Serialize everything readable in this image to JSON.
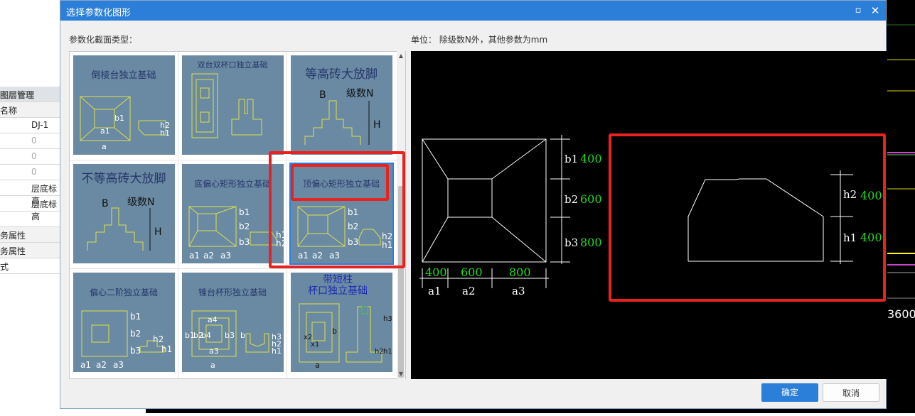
{
  "background": {
    "left_panel": {
      "header": "图层管理",
      "rows": [
        {
          "c1": "名称",
          "c2": ""
        },
        {
          "c1": "",
          "c2": "DJ-1"
        },
        {
          "c1": "",
          "c2": "0"
        },
        {
          "c1": "",
          "c2": "0"
        },
        {
          "c1": "",
          "c2": "0"
        },
        {
          "c1": "",
          "c2": "层底标高"
        },
        {
          "c1": "",
          "c2": "层底标高"
        },
        {
          "c1": "",
          "c2": ""
        },
        {
          "c1": "务属性",
          "c2": ""
        },
        {
          "c1": "务属性",
          "c2": ""
        },
        {
          "c1": "式",
          "c2": ""
        }
      ]
    },
    "right_value": "3600"
  },
  "dialog": {
    "title": "选择参数化图形",
    "left_label": "参数化截面类型：",
    "unit_label": "单位：  除级数N外，其他参数为mm",
    "ok_label": "确定",
    "cancel_label": "取消",
    "accent_color": "#2b7fd9",
    "highlight_color": "#e8221f"
  },
  "thumbnails": [
    {
      "title": "倒棱台独立基础",
      "labels": {
        "b1": "b1",
        "a1": "a1",
        "a": "a",
        "h2": "h2",
        "h1": "h1"
      }
    },
    {
      "title": "双台双杯口独立基础",
      "labels": {}
    },
    {
      "title": "等高砖大放脚",
      "labels": {
        "B": "B",
        "n": "级数N",
        "H": "H"
      }
    },
    {
      "title": "不等高砖大放脚",
      "labels": {
        "B": "B",
        "n": "级数N",
        "H": "H"
      }
    },
    {
      "title": "底偏心矩形独立基础",
      "labels": {
        "b1": "b1",
        "b2": "b2",
        "b3": "b3",
        "a1": "a1",
        "a2": "a2",
        "a3": "a3",
        "h1": "h1",
        "h2": "h2"
      }
    },
    {
      "title": "顶偏心矩形独立基础",
      "labels": {
        "b1": "b1",
        "b2": "b2",
        "b3": "b3",
        "a1": "a1",
        "a2": "a2",
        "a3": "a3",
        "h1": "h1",
        "h2": "h2"
      }
    },
    {
      "title": "偏心二阶独立基础",
      "labels": {
        "b1": "b1",
        "b2": "b2",
        "b3": "b3",
        "a1": "a1",
        "a2": "a2",
        "a3": "a3",
        "h1": "h1",
        "h2": "h2"
      }
    },
    {
      "title": "锥台杯形独立基础",
      "labels": {
        "b1": "b1",
        "b2": "b2",
        "b3": "b3",
        "b4": "b4",
        "a": "a",
        "a3": "a3",
        "a4": "a4",
        "b": "b",
        "h1": "h1",
        "h2": "h2",
        "h3": "h3"
      }
    },
    {
      "title": "带短柱杯口独立基础",
      "title_line1": "带短柱",
      "title_line2": "杯口独立基础",
      "labels": {
        "a": "a",
        "b": "b",
        "x1": "x1",
        "x2": "x2",
        "h1": "h1",
        "h2": "h2",
        "h3": "h3"
      }
    }
  ],
  "preview": {
    "plan": {
      "b1_label": "b1",
      "b1_value": "400",
      "b2_label": "b2",
      "b2_value": "600",
      "b3_label": "b3",
      "b3_value": "800",
      "a1_label": "a1",
      "a1_value": "400",
      "a2_label": "a2",
      "a2_value": "600",
      "a3_label": "a3",
      "a3_value": "800"
    },
    "section": {
      "h2_label": "h2",
      "h2_value": "400",
      "h1_label": "h1",
      "h1_value": "400"
    },
    "value_color": "#22dd22"
  }
}
